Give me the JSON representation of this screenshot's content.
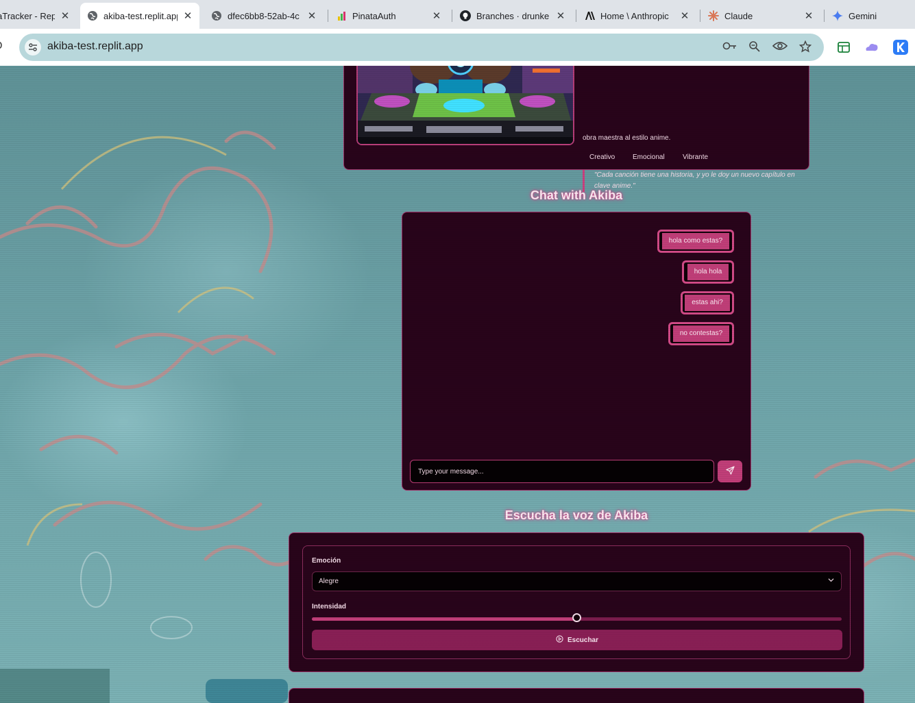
{
  "browser": {
    "tabs": [
      {
        "title": "aTracker - Replit",
        "active": false,
        "icon": "replit-icon"
      },
      {
        "title": "akiba-test.replit.app",
        "active": true,
        "icon": "globe-icon"
      },
      {
        "title": "dfec6bb8-52ab-4c",
        "active": false,
        "icon": "globe-icon"
      },
      {
        "title": "PinataAuth",
        "active": false,
        "icon": "pinata-icon"
      },
      {
        "title": "Branches · drunke",
        "active": false,
        "icon": "github-icon"
      },
      {
        "title": "Home \\ Anthropic",
        "active": false,
        "icon": "anthropic-icon"
      },
      {
        "title": "Claude",
        "active": false,
        "icon": "claude-icon"
      },
      {
        "title": "Gemini",
        "active": false,
        "icon": "gemini-icon"
      }
    ],
    "url": "akiba-test.replit.app",
    "tab_close_glyph": "✕"
  },
  "profile": {
    "description_fragment": "obra maestra al estilo anime.",
    "traits": [
      "Creativo",
      "Emocional",
      "Vibrante"
    ],
    "quote": "\"Cada canción tiene una historia, y yo le doy un nuevo capítulo en clave anime.\""
  },
  "chat": {
    "title": "Chat with Akiba",
    "messages": [
      {
        "text": "hola como estas?",
        "sender": "user"
      },
      {
        "text": "hola hola",
        "sender": "user"
      },
      {
        "text": "estas ahi?",
        "sender": "user"
      },
      {
        "text": "no contestas?",
        "sender": "user"
      }
    ],
    "input_placeholder": "Type your message..."
  },
  "voice": {
    "title": "Escucha la voz de Akiba",
    "emotion_label": "Emoción",
    "emotion_value": "Alegre",
    "intensity_label": "Intensidad",
    "intensity_fraction": 0.5,
    "listen_label": "Escuchar"
  },
  "colors": {
    "accent": "#c03e78",
    "card_bg": "#28041a",
    "card_border": "#a0346a"
  }
}
